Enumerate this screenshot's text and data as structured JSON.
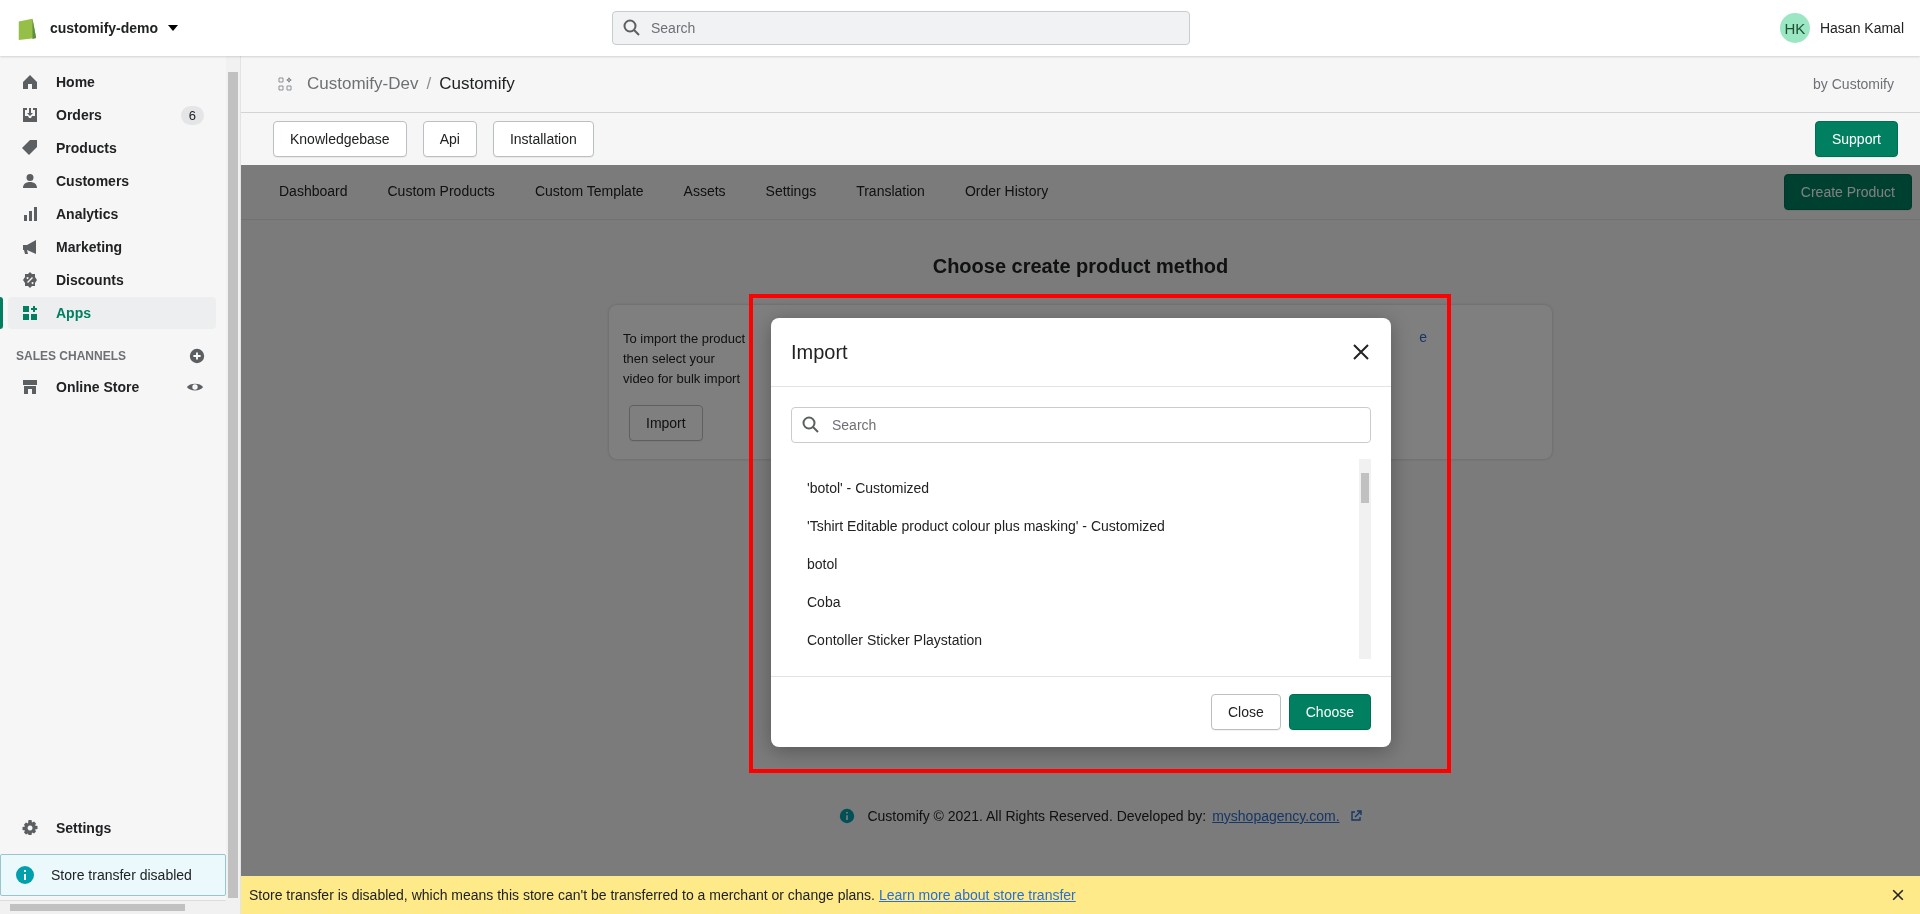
{
  "store": {
    "name": "customify-demo"
  },
  "search": {
    "placeholder": "Search"
  },
  "user": {
    "initials": "HK",
    "name": "Hasan Kamal"
  },
  "nav": [
    {
      "label": "Home",
      "selected": false
    },
    {
      "label": "Orders",
      "badge": "6",
      "selected": false
    },
    {
      "label": "Products",
      "selected": false
    },
    {
      "label": "Customers",
      "selected": false
    },
    {
      "label": "Analytics",
      "selected": false
    },
    {
      "label": "Marketing",
      "selected": false
    },
    {
      "label": "Discounts",
      "selected": false
    },
    {
      "label": "Apps",
      "selected": true
    }
  ],
  "sales_channels": {
    "title": "SALES CHANNELS",
    "items": [
      {
        "label": "Online Store"
      }
    ]
  },
  "settings": "Settings",
  "store_transfer_notice": "Store transfer disabled",
  "breadcrumb": {
    "parent": "Customify-Dev",
    "separator": "/",
    "current": "Customify"
  },
  "vendor": "by Customify",
  "toolbar_buttons": [
    "Knowledgebase",
    "Api",
    "Installation"
  ],
  "support_button": "Support",
  "app_tabs": [
    {
      "label": "Dashboard",
      "selected": false
    },
    {
      "label": "Custom Products",
      "selected": false
    },
    {
      "label": "Custom Template",
      "selected": false
    },
    {
      "label": "Assets",
      "selected": false
    },
    {
      "label": "Settings",
      "selected": false
    },
    {
      "label": "Translation",
      "selected": false
    },
    {
      "label": "Order History",
      "selected": false
    }
  ],
  "create_button": "Create Product",
  "heading": "Choose create product method",
  "card": {
    "lines": [
      "To import the product",
      "then select your",
      "video for bulk import"
    ],
    "trailing_fragment": "e",
    "button": "Import"
  },
  "footer": {
    "text": "Customify © 2021. All Rights Reserved. Developed by:",
    "link": "myshopagency.com."
  },
  "modal": {
    "title": "Import",
    "search_placeholder": "Search",
    "items": [
      "'botol' - Customized",
      "'Tshirt Editable product colour plus masking' - Customized",
      "botol",
      "Coba",
      "Contoller Sticker Playstation"
    ],
    "buttons": [
      {
        "label": "Close",
        "kind": "secondary"
      },
      {
        "label": "Choose",
        "kind": "primary"
      }
    ]
  },
  "banner": {
    "text": "Store transfer is disabled, which means this store can't be transferred to a merchant or change plans.",
    "link": "Learn more about store transfer"
  }
}
